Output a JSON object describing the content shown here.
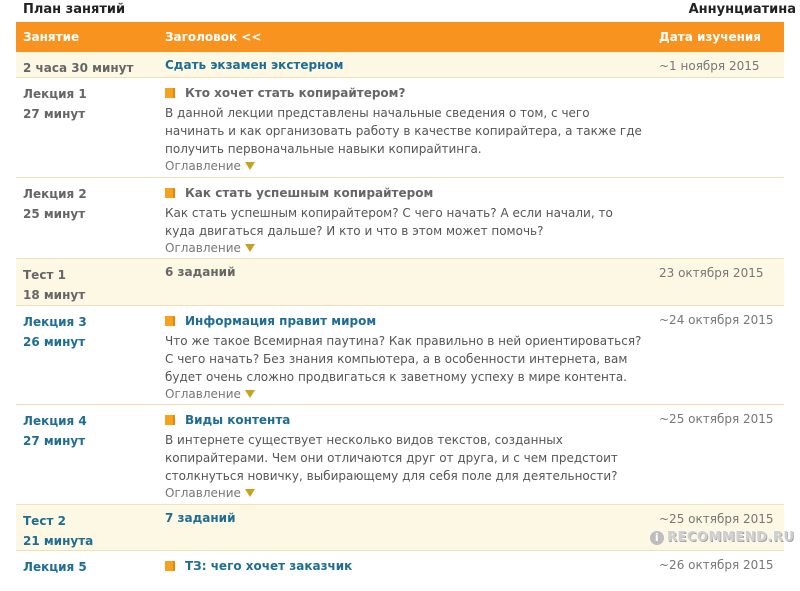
{
  "top": {
    "title": "План занятий",
    "author": "Аннунциатина"
  },
  "header": {
    "lesson": "Занятие",
    "heading": "Заголовок <<",
    "date": "Дата изучения"
  },
  "rows": [
    {
      "type": "Сдать экзамен экстерном",
      "duration": "2 часа 30 минут",
      "title": "Сдать экзамен экстерном",
      "date": "~1 ноября 2015"
    },
    {
      "type": "Лекция 1",
      "duration": "27 минут",
      "title": "Кто хочет стать копирайтером?",
      "desc": "В данной лекции представлены начальные сведения о том, с чего начинать и как организовать работу в качестве копирайтера, а также где получить первоначальные навыки копирайтинга.",
      "toc": "Оглавление",
      "date": ""
    },
    {
      "type": "Лекция 2",
      "duration": "25 минут",
      "title": "Как стать успешным копирайтером",
      "desc": "Как стать успешным копирайтером? С чего начать? А если начали, то куда двигаться дальше? И кто и что в этом может помочь?",
      "toc": "Оглавление",
      "date": ""
    },
    {
      "type": "Тест 1",
      "duration": "18 минут",
      "title": "6 заданий",
      "date": "23 октября 2015"
    },
    {
      "type": "Лекция 3",
      "duration": "26 минут",
      "title": "Информация правит миром",
      "desc": "Что же такое Всемирная паутина? Как правильно в ней ориентироваться? С чего начать? Без знания компьютера, а в особенности интернета, вам будет очень сложно продвигаться к заветному успеху в мире контента.",
      "toc": "Оглавление",
      "date": "~24 октября 2015"
    },
    {
      "type": "Лекция 4",
      "duration": "27 минут",
      "title": "Виды контента",
      "desc": "В интернете существует несколько видов текстов, созданных копирайтерами. Чем они отличаются друг от друга, и с чем предстоит столкнуться новичку, выбирающему для себя поле для деятельности?",
      "toc": "Оглавление",
      "date": "~25 октября 2015"
    },
    {
      "type": "Тест 2",
      "duration": "21 минута",
      "title": "7 заданий",
      "date": "~25 октября 2015"
    },
    {
      "type": "Лекция 5",
      "title": "ТЗ: чего хочет заказчик",
      "date": "~26 октября 2015"
    }
  ],
  "watermark": "RECOMMEND.RU",
  "colors": {
    "header": "#f7931e",
    "link": "#1d6d94",
    "row_alt": "#fdf8e4"
  }
}
